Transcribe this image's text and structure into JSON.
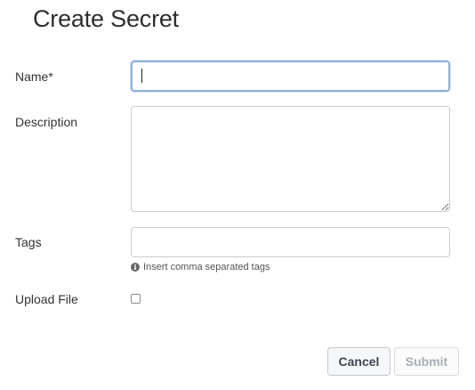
{
  "dialog": {
    "title": "Create Secret"
  },
  "form": {
    "name": {
      "label": "Name*",
      "value": ""
    },
    "description": {
      "label": "Description",
      "value": ""
    },
    "tags": {
      "label": "Tags",
      "value": "",
      "hint": "Insert comma separated tags",
      "hint_icon": "info-circle-icon"
    },
    "upload_file": {
      "label": "Upload File",
      "checked": false
    }
  },
  "actions": {
    "cancel_label": "Cancel",
    "submit_label": "Submit"
  }
}
